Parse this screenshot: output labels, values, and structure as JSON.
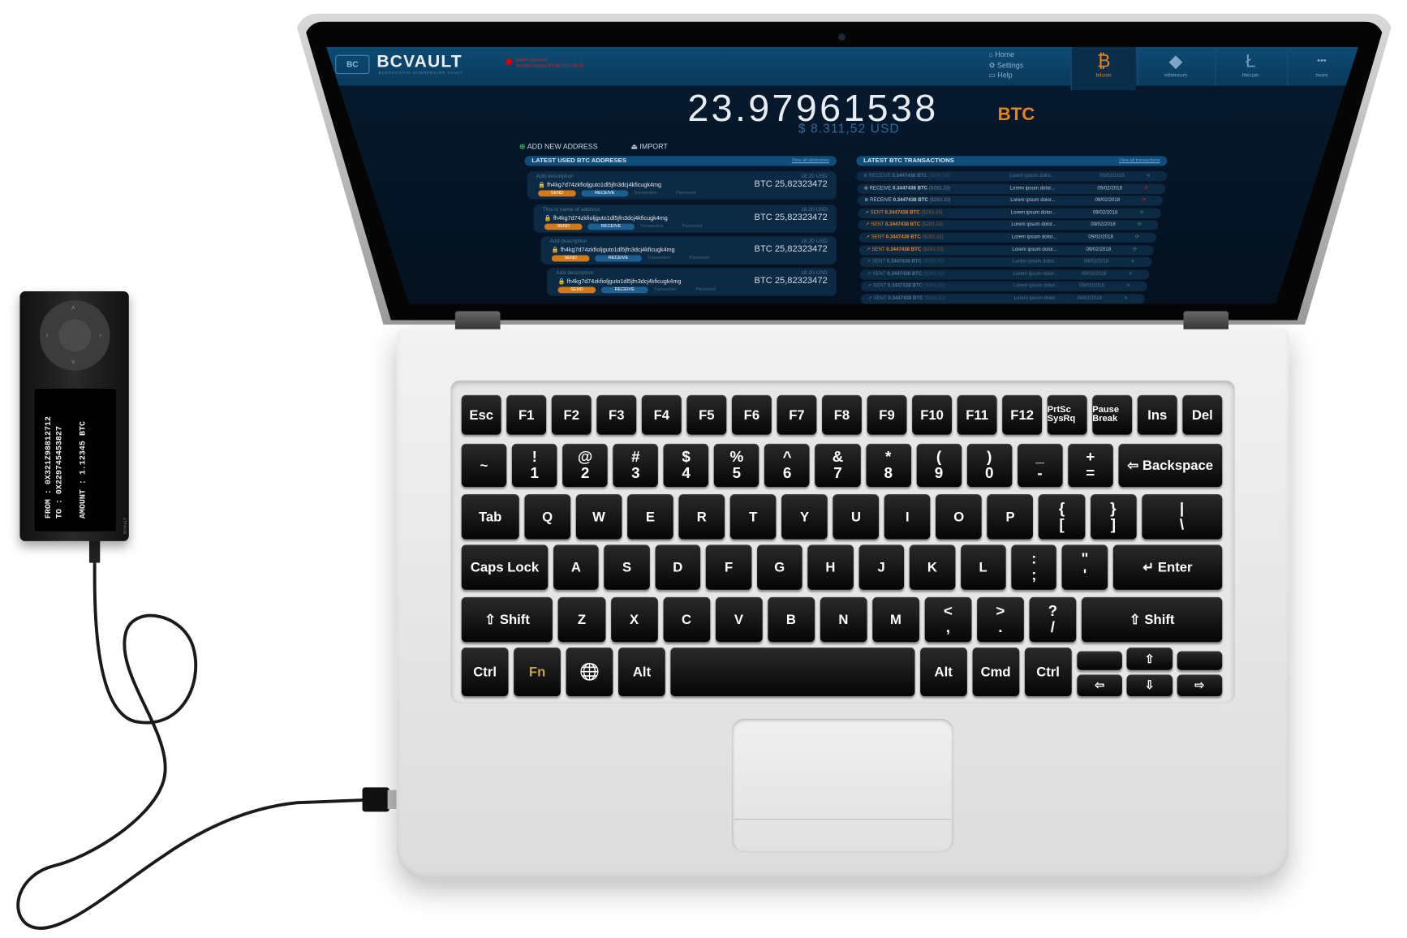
{
  "app": {
    "brand": "BCVAULT",
    "brand_sub": "BLOCKCHAIN CURRENCIES VAULT",
    "logo_text": "BC",
    "status_text": [
      "Wallet unlocked",
      "Session expires 07:09:18 in 15:15"
    ],
    "nav": [
      "Home",
      "Settings",
      "Help"
    ],
    "tabs": [
      {
        "label": "bitcoin",
        "icon": "bitcoin-icon",
        "glyph": "₿",
        "active": true
      },
      {
        "label": "ethereum",
        "icon": "ethereum-icon",
        "glyph": "◆",
        "active": false
      },
      {
        "label": "litecoin",
        "icon": "litecoin-icon",
        "glyph": "Ł",
        "active": false
      },
      {
        "label": "more",
        "icon": "more-icon",
        "glyph": "•••",
        "active": false
      }
    ],
    "balance": "23.97961538",
    "balance_unit": "BTC",
    "balance_usd": "$ 8.311,52 USD",
    "add_address": "ADD NEW ADDRESS",
    "import": "IMPORT",
    "addresses_title": "LATEST USED BTC ADDRESES",
    "addresses_link": "View all addresses",
    "transactions_title": "LATEST BTC TRANSACTIONS",
    "transactions_link": "View all transactions",
    "addresses": [
      {
        "desc": "Add description",
        "address": "fh4kg7d74zkfioljguto1dl5jfn3dcj4kficugk4mg",
        "usd": "18.20 USD",
        "amount": "BTC 25,82323472"
      },
      {
        "desc": "This is name of address",
        "address": "fh4kg7d74zkfioljguto1dl5jfn3dcj4kficugk4mg",
        "usd": "18.20 USD",
        "amount": "BTC 25,82323472"
      },
      {
        "desc": "Add description",
        "address": "fh4kg7d74zkfioljguto1dl5jfn3dcj4kficugk4mg",
        "usd": "18.20 USD",
        "amount": "BTC 25,82323472"
      },
      {
        "desc": "Add description",
        "address": "fh4kg7d74zkfioljguto1dl5jfn3dcj4kficugk4mg",
        "usd": "18.20 USD",
        "amount": "BTC 25,82323472"
      }
    ],
    "address_actions": {
      "send": "SEND",
      "receive": "RECEIVE",
      "transaction": "Transaction",
      "password": "Password"
    },
    "transactions": [
      {
        "type": "RECEIVE",
        "amount": "0.3447438 BTC",
        "usd": "($283,33)",
        "desc": "Lorem ipsum dolor...",
        "date": "09/02/2018",
        "status": "x",
        "style": "old"
      },
      {
        "type": "RECEIVE",
        "amount": "0.3447438 BTC",
        "usd": "($283,33)",
        "desc": "Lorem ipsum dolor...",
        "date": "09/02/2018",
        "status": "failed",
        "style": "recv"
      },
      {
        "type": "RECEIVE",
        "amount": "0.3447438 BTC",
        "usd": "($283,33)",
        "desc": "Lorem ipsum dolor...",
        "date": "09/02/2018",
        "status": "failed",
        "style": "recv"
      },
      {
        "type": "SENT",
        "amount": "0.3447438 BTC",
        "usd": "($283,33)",
        "desc": "Lorem ipsum dolor...",
        "date": "09/02/2018",
        "status": "ok",
        "style": "sent"
      },
      {
        "type": "SENT",
        "amount": "0.3447438 BTC",
        "usd": "($283,33)",
        "desc": "Lorem ipsum dolor...",
        "date": "09/02/2018",
        "status": "ok",
        "style": "sent"
      },
      {
        "type": "SENT",
        "amount": "0.3447438 BTC",
        "usd": "($283,33)",
        "desc": "Lorem ipsum dolor...",
        "date": "09/02/2018",
        "status": "ok",
        "style": "sent"
      },
      {
        "type": "SENT",
        "amount": "0.3447438 BTC",
        "usd": "($283,33)",
        "desc": "Lorem ipsum dolor...",
        "date": "09/02/2018",
        "status": "ok",
        "style": "sent"
      },
      {
        "type": "SENT",
        "amount": "0.3447438 BTC",
        "usd": "($283,33)",
        "desc": "Lorem ipsum dolor...",
        "date": "09/02/2018",
        "status": "x",
        "style": "old"
      },
      {
        "type": "SENT",
        "amount": "0.3447438 BTC",
        "usd": "($283,33)",
        "desc": "Lorem ipsum dolor...",
        "date": "09/02/2018",
        "status": "x",
        "style": "old"
      },
      {
        "type": "SENT",
        "amount": "0.3447438 BTC",
        "usd": "($283,33)",
        "desc": "Lorem ipsum dolor...",
        "date": "09/02/2018",
        "status": "x",
        "style": "old"
      },
      {
        "type": "SENT",
        "amount": "0.3447438 BTC",
        "usd": "($283,33)",
        "desc": "Lorem ipsum dolor...",
        "date": "09/02/2018",
        "status": "x",
        "style": "old"
      }
    ],
    "status_colors": {
      "ok": "#22aa44",
      "failed": "#dd2222",
      "x": "#4f7090"
    },
    "accent": "#e8841a"
  },
  "keyboard": {
    "rows": [
      [
        "Esc",
        "F1",
        "F2",
        "F3",
        "F4",
        "F5",
        "F6",
        "F7",
        "F8",
        "F9",
        "F10",
        "F11",
        "F12",
        "PrtSc SysRq",
        "Pause Break",
        "Ins",
        "Del"
      ],
      [
        "~",
        [
          "!",
          "1"
        ],
        [
          "@",
          "2"
        ],
        [
          "#",
          "3"
        ],
        [
          "$",
          "4"
        ],
        [
          "%",
          "5"
        ],
        [
          "^",
          "6"
        ],
        [
          "&",
          "7"
        ],
        [
          "*",
          "8"
        ],
        [
          "(",
          "9"
        ],
        [
          ")",
          "0"
        ],
        [
          "_",
          "-"
        ],
        [
          "+",
          "="
        ],
        "⇦ Backspace"
      ],
      [
        "Tab",
        "Q",
        "W",
        "E",
        "R",
        "T",
        "Y",
        "U",
        "I",
        "O",
        "P",
        [
          "{",
          "["
        ],
        [
          "}",
          "]"
        ],
        [
          "|",
          "\\"
        ]
      ],
      [
        "Caps Lock",
        "A",
        "S",
        "D",
        "F",
        "G",
        "H",
        "J",
        "K",
        "L",
        [
          ":",
          ";"
        ],
        [
          "\"",
          "'"
        ],
        "↵ Enter"
      ],
      [
        "⇧ Shift",
        "Z",
        "X",
        "C",
        "V",
        "B",
        "N",
        "M",
        [
          "<",
          ","
        ],
        [
          ">",
          "."
        ],
        [
          "?",
          "/"
        ],
        "⇧ Shift"
      ],
      [
        "Ctrl",
        "Fn",
        "🌐",
        "Alt",
        " ",
        "Alt",
        "Cmd",
        "Ctrl"
      ]
    ],
    "arrows": [
      "",
      "⇧",
      "",
      "⇦",
      "⇩",
      "⇨"
    ]
  },
  "device": {
    "lines": [
      "FROM : 0X321Z98812712",
      "TO : 0X229745453827",
      "AMOUNT : 1.12345 BTC"
    ],
    "brand": "BCVAULT"
  }
}
